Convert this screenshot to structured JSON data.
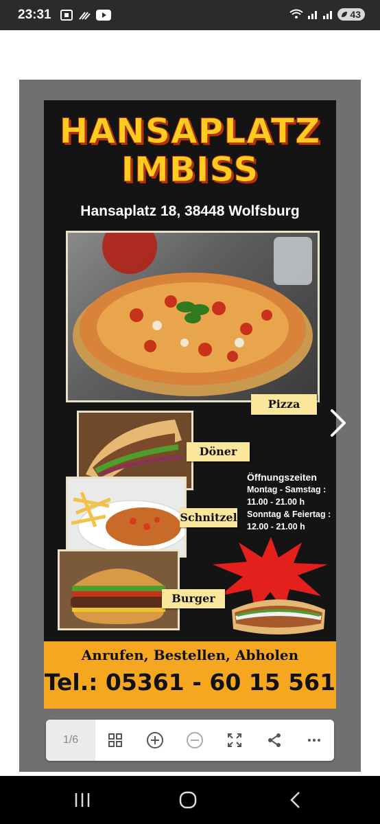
{
  "status_bar": {
    "time": "23:31",
    "battery": "43"
  },
  "flyer": {
    "title_line1": "HANSAPLATZ",
    "title_line2": "IMBISS",
    "address": "Hansaplatz 18, 38448 Wolfsburg",
    "items": [
      "Pizza",
      "Döner",
      "Schnitzel",
      "Burger"
    ],
    "hours": {
      "heading": "Öffnungszeiten",
      "weekday_label": "Montag - Samstag :",
      "weekday_time": "11.00 - 21.00  h",
      "weekend_label": "Sonntag & Feiertag :",
      "weekend_time": "12.00 - 21.00  h"
    },
    "order_line": "Anrufen, Bestellen, Abholen",
    "phone": "Tel.: 05361 - 60 15 561"
  },
  "toolbar": {
    "page_indicator": "1/6",
    "icons": [
      "grid-icon",
      "zoom-in-icon",
      "zoom-out-icon",
      "fullscreen-icon",
      "share-icon",
      "more-icon"
    ]
  },
  "colors": {
    "title_yellow": "#ffcc1f",
    "title_outline": "#b5320d",
    "band_orange": "#f5a81f",
    "label_bg": "#fbe79c",
    "starburst_red": "#e3201b"
  }
}
